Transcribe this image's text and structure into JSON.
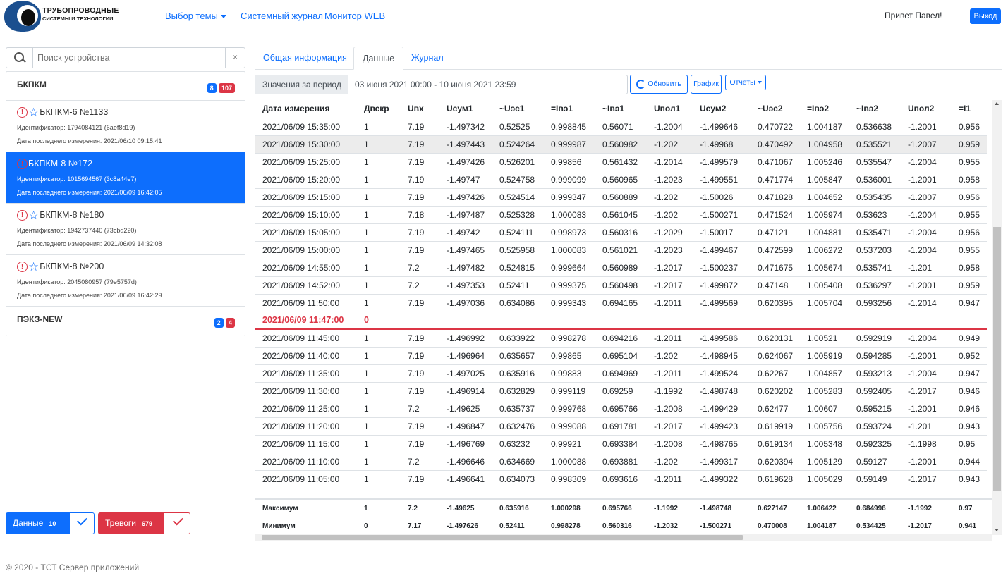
{
  "header": {
    "logo_line1": "ТРУБОПРОВОДНЫЕ",
    "logo_line2": "СИСТЕМЫ И ТЕХНОЛОГИИ",
    "nav": [
      "Выбор темы",
      "Системный журнал",
      "Монитор WEB"
    ],
    "greeting": "Привет Павел!",
    "logout": "Выход"
  },
  "sidebar": {
    "search_placeholder": "Поиск устройства",
    "clear": "×",
    "groups": [
      {
        "name": "БКПКМ",
        "badge_blue": "8",
        "badge_red": "107"
      },
      {
        "name": "ПЭКЗ-NEW",
        "badge_blue": "2",
        "badge_red": "4"
      }
    ],
    "devices": [
      {
        "title": "БКПКМ-6 №1133",
        "id": "Идентификатор: 1794084121 (6aef8d19)",
        "date": "Дата последнего измерения: 2021/06/10 09:15:41",
        "selected": false
      },
      {
        "title": "БКПКМ-8 №172",
        "id": "Идентификатор: 1015694567 (3c8a44e7)",
        "date": "Дата последнего измерения: 2021/06/09 16:42:05",
        "selected": true
      },
      {
        "title": "БКПКМ-8 №180",
        "id": "Идентификатор: 1942737440 (73cbd220)",
        "date": "Дата последнего измерения: 2021/06/09 14:32:08",
        "selected": false
      },
      {
        "title": "БКПКМ-8 №200",
        "id": "Идентификатор: 2045080957 (79e5757d)",
        "date": "Дата последнего измерения: 2021/06/09 16:42:29",
        "selected": false
      }
    ],
    "btn_data": {
      "label": "Данные",
      "count": "10"
    },
    "btn_alarms": {
      "label": "Тревоги",
      "count": "679"
    }
  },
  "tabs": [
    "Общая информация",
    "Данные",
    "Журнал"
  ],
  "toolbar": {
    "period_label": "Значения за период",
    "period_value": "03 июня 2021 00:00 - 10 июня 2021 23:59",
    "refresh": "Обновить",
    "graph": "График",
    "reports": "Отчеты"
  },
  "table": {
    "columns": [
      "Дата измерения",
      "Двскр",
      "Uвх",
      "Uсум1",
      "~Uэс1",
      "=Iвэ1",
      "~Iвэ1",
      "Uпол1",
      "Uсум2",
      "~Uэс2",
      "=Iвэ2",
      "~Iвэ2",
      "Uпол2",
      "=I1"
    ],
    "rows": [
      [
        "2021/06/09 15:35:00",
        "1",
        "7.19",
        "-1.497342",
        "0.52525",
        "0.998845",
        "0.56071",
        "-1.2004",
        "-1.499646",
        "0.470722",
        "1.004187",
        "0.536638",
        "-1.2001",
        "0.956"
      ],
      [
        "2021/06/09 15:30:00",
        "1",
        "7.19",
        "-1.497443",
        "0.524264",
        "0.999987",
        "0.560982",
        "-1.202",
        "-1.49968",
        "0.470492",
        "1.004958",
        "0.535521",
        "-1.2007",
        "0.959"
      ],
      [
        "2021/06/09 15:25:00",
        "1",
        "7.19",
        "-1.497426",
        "0.526201",
        "0.99856",
        "0.561432",
        "-1.2014",
        "-1.499579",
        "0.471067",
        "1.005246",
        "0.535547",
        "-1.2004",
        "0.955"
      ],
      [
        "2021/06/09 15:20:00",
        "1",
        "7.19",
        "-1.49747",
        "0.524758",
        "0.999099",
        "0.560965",
        "-1.2023",
        "-1.499551",
        "0.471774",
        "1.005847",
        "0.536001",
        "-1.2001",
        "0.958"
      ],
      [
        "2021/06/09 15:15:00",
        "1",
        "7.19",
        "-1.497426",
        "0.524514",
        "0.999347",
        "0.560889",
        "-1.202",
        "-1.50026",
        "0.471828",
        "1.004652",
        "0.535435",
        "-1.2007",
        "0.956"
      ],
      [
        "2021/06/09 15:10:00",
        "1",
        "7.18",
        "-1.497487",
        "0.525328",
        "1.000083",
        "0.561045",
        "-1.202",
        "-1.500271",
        "0.471524",
        "1.005974",
        "0.53623",
        "-1.2004",
        "0.955"
      ],
      [
        "2021/06/09 15:05:00",
        "1",
        "7.19",
        "-1.49742",
        "0.524111",
        "0.998973",
        "0.560316",
        "-1.2029",
        "-1.50017",
        "0.47121",
        "1.004881",
        "0.535471",
        "-1.2004",
        "0.956"
      ],
      [
        "2021/06/09 15:00:00",
        "1",
        "7.19",
        "-1.497465",
        "0.525958",
        "1.000083",
        "0.561021",
        "-1.2023",
        "-1.499467",
        "0.472599",
        "1.006272",
        "0.537203",
        "-1.2004",
        "0.955"
      ],
      [
        "2021/06/09 14:55:00",
        "1",
        "7.2",
        "-1.497482",
        "0.524815",
        "0.999664",
        "0.560989",
        "-1.2017",
        "-1.500237",
        "0.471675",
        "1.005674",
        "0.535741",
        "-1.201",
        "0.958"
      ],
      [
        "2021/06/09 14:52:00",
        "1",
        "7.2",
        "-1.497353",
        "0.52411",
        "0.999375",
        "0.560498",
        "-1.2017",
        "-1.499872",
        "0.47148",
        "1.005408",
        "0.536297",
        "-1.2001",
        "0.959"
      ],
      [
        "2021/06/09 11:50:00",
        "1",
        "7.19",
        "-1.497036",
        "0.634086",
        "0.999343",
        "0.694165",
        "-1.2011",
        "-1.499569",
        "0.620395",
        "1.005704",
        "0.593256",
        "-1.2014",
        "0.947"
      ],
      [
        "2021/06/09 11:47:00",
        "0",
        "",
        "",
        "",
        "",
        "",
        "",
        "",
        "",
        "",
        "",
        "",
        ""
      ],
      [
        "2021/06/09 11:45:00",
        "1",
        "7.19",
        "-1.496992",
        "0.633922",
        "0.998278",
        "0.694216",
        "-1.2011",
        "-1.499586",
        "0.620131",
        "1.00521",
        "0.592919",
        "-1.2004",
        "0.949"
      ],
      [
        "2021/06/09 11:40:00",
        "1",
        "7.19",
        "-1.496964",
        "0.635657",
        "0.99865",
        "0.695104",
        "-1.202",
        "-1.498945",
        "0.624067",
        "1.005919",
        "0.594285",
        "-1.2001",
        "0.952"
      ],
      [
        "2021/06/09 11:35:00",
        "1",
        "7.19",
        "-1.497025",
        "0.635916",
        "0.99883",
        "0.694969",
        "-1.2011",
        "-1.499524",
        "0.62267",
        "1.004857",
        "0.593213",
        "-1.2004",
        "0.947"
      ],
      [
        "2021/06/09 11:30:00",
        "1",
        "7.19",
        "-1.496914",
        "0.632829",
        "0.999119",
        "0.69259",
        "-1.1992",
        "-1.498748",
        "0.620202",
        "1.005283",
        "0.592405",
        "-1.2017",
        "0.946"
      ],
      [
        "2021/06/09 11:25:00",
        "1",
        "7.2",
        "-1.49625",
        "0.635737",
        "0.999768",
        "0.695766",
        "-1.2008",
        "-1.499429",
        "0.62477",
        "1.00607",
        "0.595215",
        "-1.2001",
        "0.946"
      ],
      [
        "2021/06/09 11:20:00",
        "1",
        "7.19",
        "-1.496847",
        "0.632476",
        "0.999088",
        "0.691781",
        "-1.2017",
        "-1.499423",
        "0.619919",
        "1.005756",
        "0.593724",
        "-1.201",
        "0.943"
      ],
      [
        "2021/06/09 11:15:00",
        "1",
        "7.19",
        "-1.496769",
        "0.63232",
        "0.99921",
        "0.693384",
        "-1.2008",
        "-1.498765",
        "0.619134",
        "1.005348",
        "0.592325",
        "-1.1998",
        "0.95"
      ],
      [
        "2021/06/09 11:10:00",
        "1",
        "7.2",
        "-1.496646",
        "0.634669",
        "1.000088",
        "0.693881",
        "-1.202",
        "-1.499317",
        "0.620394",
        "1.005129",
        "0.59127",
        "-1.2001",
        "0.944"
      ],
      [
        "2021/06/09 11:05:00",
        "1",
        "7.19",
        "-1.496641",
        "0.634073",
        "0.998309",
        "0.693616",
        "-1.2011",
        "-1.499322",
        "0.619628",
        "1.005029",
        "0.59149",
        "-1.2017",
        "0.943"
      ]
    ],
    "highlight_row": 1,
    "error_row": 11,
    "summary": [
      [
        "Максимум",
        "1",
        "7.2",
        "-1.49625",
        "0.635916",
        "1.000298",
        "0.695766",
        "-1.1992",
        "-1.498748",
        "0.627147",
        "1.006422",
        "0.684996",
        "-1.1992",
        "0.97"
      ],
      [
        "Минимум",
        "0",
        "7.17",
        "-1.497626",
        "0.52411",
        "0.998278",
        "0.560316",
        "-1.2032",
        "-1.500271",
        "0.470008",
        "1.004187",
        "0.534425",
        "-1.2017",
        "0.941"
      ]
    ]
  },
  "footer": "© 2020 - ТСТ Сервер приложений",
  "colors": {
    "primary": "#0d6efd",
    "danger": "#dc3545"
  }
}
